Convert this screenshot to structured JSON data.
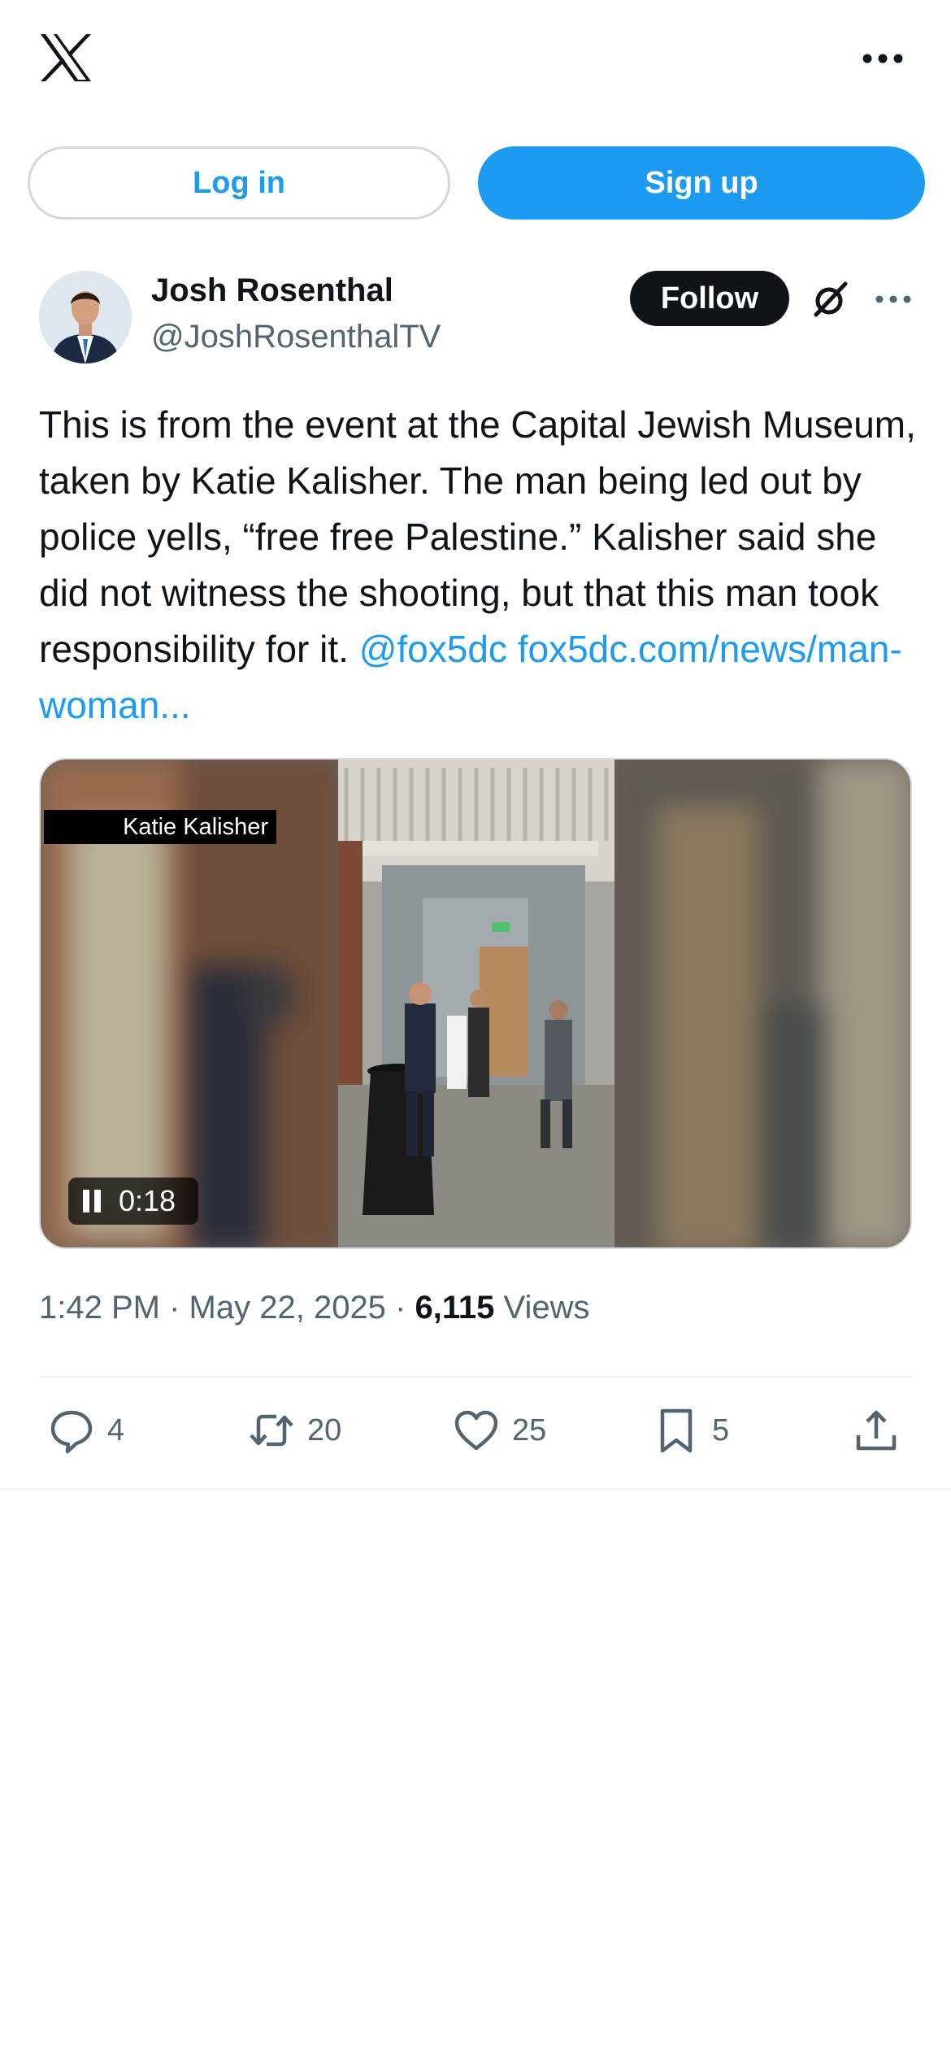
{
  "header": {
    "logo_icon": "x-logo-icon",
    "more_icon": "more-icon"
  },
  "auth": {
    "login_label": "Log in",
    "signup_label": "Sign up"
  },
  "tweet": {
    "author": {
      "name": "Josh Rosenthal",
      "handle": "@JoshRosenthalTV"
    },
    "follow_label": "Follow",
    "text": "This is from the event at the Capital Jewish Museum, taken by Katie Kalisher. The man being led out by police yells, “free free Palestine.” Kalisher said she did not witness the shooting, but that this man took responsibility for it.",
    "mention": "@fox5dc",
    "link": "fox5dc.com/news/man-woman...",
    "media": {
      "credit": "Katie Kalisher",
      "time": "0:18",
      "state_icon": "pause-icon"
    },
    "meta": {
      "time": "1:42 PM",
      "separator": "·",
      "date": "May 22, 2025",
      "views_count": "6,115",
      "views_label": "Views"
    },
    "actions": {
      "replies": "4",
      "reposts": "20",
      "likes": "25",
      "bookmarks": "5"
    }
  },
  "colors": {
    "accent": "#1d9bf0",
    "text": "#0f1419",
    "muted": "#536471",
    "border": "#cfd9de"
  }
}
